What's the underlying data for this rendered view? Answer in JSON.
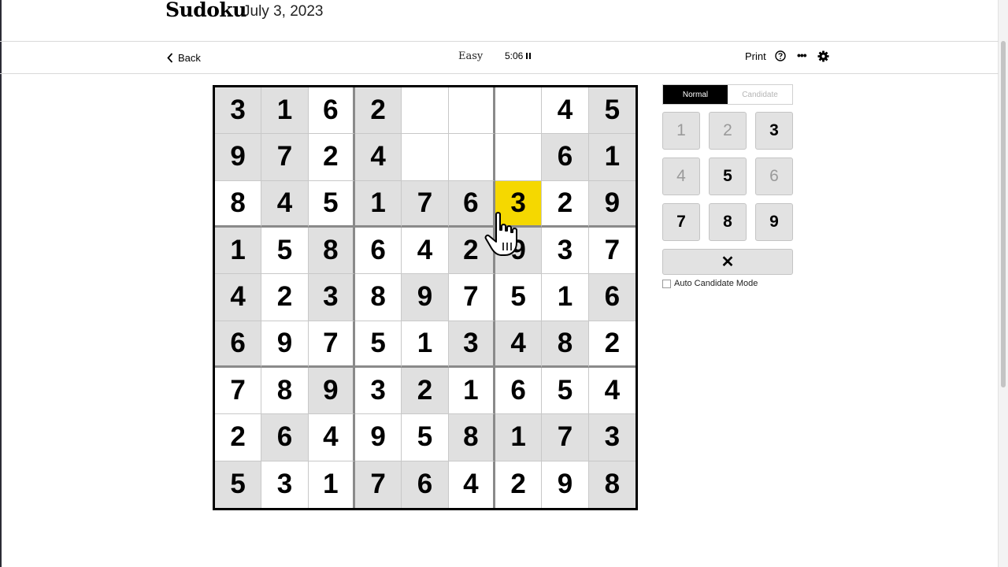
{
  "header": {
    "title": "Sudoku",
    "date": "July 3, 2023"
  },
  "toolbar": {
    "back_label": "Back",
    "difficulty": "Easy",
    "timer": "5:06",
    "print_label": "Print",
    "icons": [
      "chevron-left-icon",
      "pause-icon",
      "help-icon",
      "more-icon",
      "gear-icon"
    ]
  },
  "board": {
    "rows": [
      [
        "3",
        "1",
        "6",
        "2",
        "",
        "",
        "",
        "4",
        "5"
      ],
      [
        "9",
        "7",
        "2",
        "4",
        "",
        "",
        "",
        "6",
        "1"
      ],
      [
        "8",
        "4",
        "5",
        "1",
        "7",
        "6",
        "3",
        "2",
        "9"
      ],
      [
        "1",
        "5",
        "8",
        "6",
        "4",
        "2",
        "9",
        "3",
        "7"
      ],
      [
        "4",
        "2",
        "3",
        "8",
        "9",
        "7",
        "5",
        "1",
        "6"
      ],
      [
        "6",
        "9",
        "7",
        "5",
        "1",
        "3",
        "4",
        "8",
        "2"
      ],
      [
        "7",
        "8",
        "9",
        "3",
        "2",
        "1",
        "6",
        "5",
        "4"
      ],
      [
        "2",
        "6",
        "4",
        "9",
        "5",
        "8",
        "1",
        "7",
        "3"
      ],
      [
        "5",
        "3",
        "1",
        "7",
        "6",
        "4",
        "2",
        "9",
        "8"
      ]
    ],
    "givens": [
      [
        1,
        1,
        0,
        1,
        0,
        0,
        0,
        0,
        1
      ],
      [
        1,
        1,
        0,
        1,
        0,
        0,
        0,
        1,
        1
      ],
      [
        0,
        1,
        0,
        1,
        1,
        1,
        0,
        0,
        1
      ],
      [
        1,
        0,
        1,
        0,
        0,
        1,
        1,
        0,
        0
      ],
      [
        1,
        0,
        1,
        0,
        1,
        0,
        0,
        0,
        1
      ],
      [
        1,
        0,
        0,
        0,
        0,
        1,
        1,
        1,
        0
      ],
      [
        0,
        0,
        1,
        0,
        1,
        0,
        0,
        0,
        0
      ],
      [
        0,
        1,
        0,
        0,
        0,
        1,
        1,
        1,
        1
      ],
      [
        1,
        0,
        0,
        1,
        1,
        0,
        0,
        0,
        1
      ]
    ],
    "selected": [
      2,
      6
    ],
    "selected_color": "#f5d800",
    "given_color": "#e0e0e0"
  },
  "controls": {
    "mode_normal": "Normal",
    "mode_candidate": "Candidate",
    "numbers": [
      {
        "label": "1",
        "state": "used"
      },
      {
        "label": "2",
        "state": "used"
      },
      {
        "label": "3",
        "state": "available"
      },
      {
        "label": "4",
        "state": "used"
      },
      {
        "label": "5",
        "state": "available"
      },
      {
        "label": "6",
        "state": "used"
      },
      {
        "label": "7",
        "state": "available"
      },
      {
        "label": "8",
        "state": "available"
      },
      {
        "label": "9",
        "state": "available"
      }
    ],
    "erase_label": "✕",
    "auto_candidate_label": "Auto Candidate Mode",
    "auto_candidate_checked": false
  }
}
